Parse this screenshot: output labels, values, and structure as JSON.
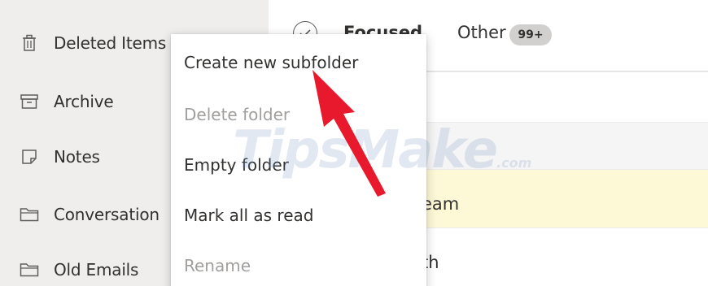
{
  "sidebar": {
    "folders": [
      {
        "label": "Deleted Items",
        "icon": "trash-icon"
      },
      {
        "label": "Archive",
        "icon": "archive-icon"
      },
      {
        "label": "Notes",
        "icon": "note-icon"
      },
      {
        "label": "Conversation",
        "icon": "folder-icon"
      },
      {
        "label": "Old Emails",
        "icon": "folder-icon"
      }
    ]
  },
  "main": {
    "tabs": [
      {
        "label": "Focused"
      },
      {
        "label": "Other",
        "badge": "99+"
      }
    ],
    "rows": [
      {
        "text": "eam"
      },
      {
        "text": "th"
      }
    ]
  },
  "context_menu": {
    "items": [
      {
        "label": "Create new subfolder",
        "enabled": true
      },
      {
        "label": "Delete folder",
        "enabled": false
      },
      {
        "label": "Empty folder",
        "enabled": true
      },
      {
        "label": "Mark all as read",
        "enabled": true
      },
      {
        "label": "Rename",
        "enabled": false
      }
    ]
  },
  "watermark": {
    "text": "TipsMake",
    "suffix": ".com"
  },
  "colors": {
    "sidebar_bg": "#efeeed",
    "highlight_row": "#fdf9d7",
    "arrow": "#e8192c",
    "disabled_text": "#a19f9d",
    "badge_bg": "#d2d0ce"
  }
}
